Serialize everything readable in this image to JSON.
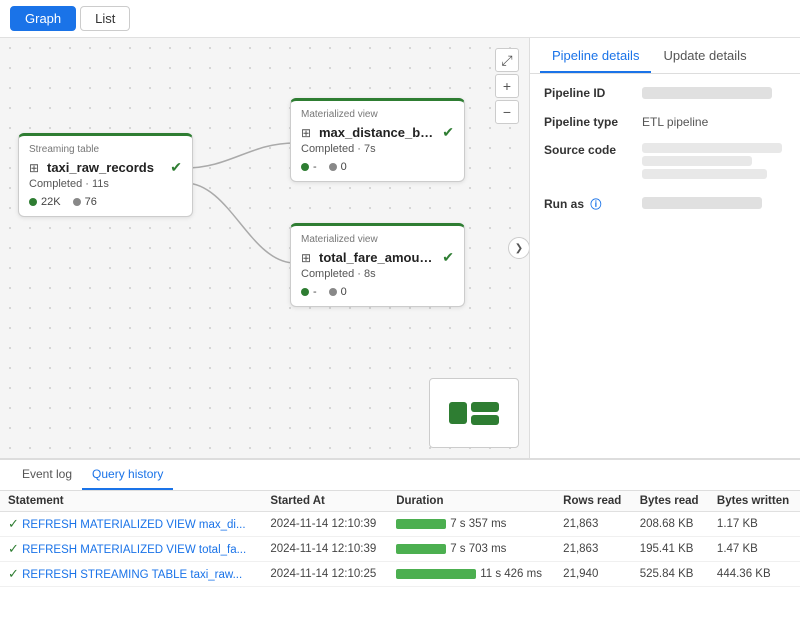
{
  "tabs": {
    "graph": "Graph",
    "list": "List",
    "active": "graph"
  },
  "graph": {
    "nodes": [
      {
        "id": "streaming-table",
        "type_label": "Streaming table",
        "icon": "⊞",
        "name": "taxi_raw_records",
        "status": "Completed · 11s",
        "metrics": [
          {
            "dot": "green",
            "value": "22K"
          },
          {
            "dot": "gray",
            "value": "76"
          }
        ]
      },
      {
        "id": "mat-view-1",
        "type_label": "Materialized view",
        "icon": "⊞",
        "name": "max_distance_by_...",
        "status": "Completed · 7s",
        "metrics": [
          {
            "dot": "green",
            "value": "-"
          },
          {
            "dot": "gray",
            "value": "0"
          }
        ]
      },
      {
        "id": "mat-view-2",
        "type_label": "Materialized view",
        "icon": "⊞",
        "name": "total_fare_amount...",
        "status": "Completed · 8s",
        "metrics": [
          {
            "dot": "green",
            "value": "-"
          },
          {
            "dot": "gray",
            "value": "0"
          }
        ]
      }
    ],
    "collapse_button": "❯",
    "zoom_expand": "⤢",
    "zoom_plus": "+",
    "zoom_minus": "−"
  },
  "right_panel": {
    "tabs": [
      "Pipeline details",
      "Update details"
    ],
    "active_tab": "Pipeline details",
    "fields": [
      {
        "label": "Pipeline ID",
        "value": "blurred"
      },
      {
        "label": "Pipeline type",
        "value": "ETL pipeline"
      },
      {
        "label": "Source code",
        "value": "blurred_multi"
      },
      {
        "label": "Run as",
        "value": "blurred"
      }
    ]
  },
  "bottom": {
    "tabs": [
      "Event log",
      "Query history"
    ],
    "active_tab": "Query history",
    "table": {
      "columns": [
        "Statement",
        "Started At",
        "Duration",
        "Rows read",
        "Bytes read",
        "Bytes written"
      ],
      "rows": [
        {
          "status": "✓",
          "statement": "REFRESH MATERIALIZED VIEW max_di...",
          "started_at": "2024-11-14 12:10:39",
          "duration_bar_width": 50,
          "duration_text": "7 s 357 ms",
          "rows_read": "21,863",
          "bytes_read": "208.68 KB",
          "bytes_written": "1.17 KB"
        },
        {
          "status": "✓",
          "statement": "REFRESH MATERIALIZED VIEW total_fa...",
          "started_at": "2024-11-14 12:10:39",
          "duration_bar_width": 50,
          "duration_text": "7 s 703 ms",
          "rows_read": "21,863",
          "bytes_read": "195.41 KB",
          "bytes_written": "1.47 KB"
        },
        {
          "status": "✓",
          "statement": "REFRESH STREAMING TABLE taxi_raw...",
          "started_at": "2024-11-14 12:10:25",
          "duration_bar_width": 80,
          "duration_text": "11 s 426 ms",
          "rows_read": "21,940",
          "bytes_read": "525.84 KB",
          "bytes_written": "444.36 KB"
        }
      ]
    }
  }
}
